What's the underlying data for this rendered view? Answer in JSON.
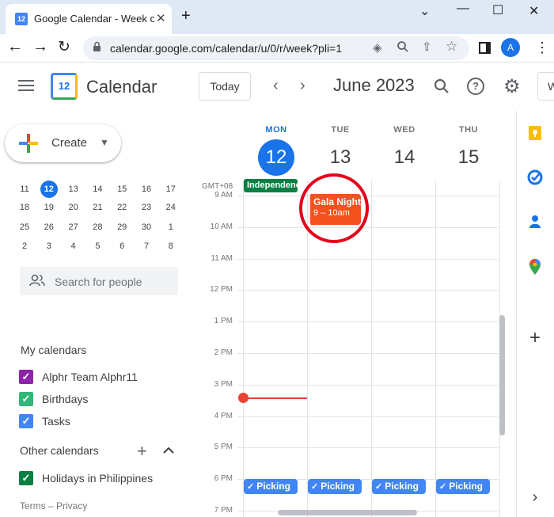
{
  "browser": {
    "tab_title": "Google Calendar - Week of",
    "tab_favicon_text": "12",
    "url": "calendar.google.com/calendar/u/0/r/week?pli=1",
    "avatar_letter": "A"
  },
  "header": {
    "app_name": "Calendar",
    "logo_text": "12",
    "today_label": "Today",
    "month_label": "June 2023",
    "view_label": "W"
  },
  "sidebar": {
    "create_label": "Create",
    "mini_calendar": [
      [
        {
          "d": "11"
        },
        {
          "d": "12",
          "sel": true
        },
        {
          "d": "13"
        },
        {
          "d": "14"
        },
        {
          "d": "15"
        },
        {
          "d": "16"
        },
        {
          "d": "17"
        }
      ],
      [
        {
          "d": "18"
        },
        {
          "d": "19"
        },
        {
          "d": "20"
        },
        {
          "d": "21"
        },
        {
          "d": "22"
        },
        {
          "d": "23"
        },
        {
          "d": "24"
        }
      ],
      [
        {
          "d": "25"
        },
        {
          "d": "26"
        },
        {
          "d": "27"
        },
        {
          "d": "28"
        },
        {
          "d": "29"
        },
        {
          "d": "30"
        },
        {
          "d": "1"
        }
      ],
      [
        {
          "d": "2"
        },
        {
          "d": "3"
        },
        {
          "d": "4"
        },
        {
          "d": "5"
        },
        {
          "d": "6"
        },
        {
          "d": "7"
        },
        {
          "d": "8"
        }
      ]
    ],
    "search_placeholder": "Search for people",
    "my_calendars_title": "My calendars",
    "my_calendars": [
      {
        "label": "Alphr Team Alphr11",
        "color": "#8e24aa"
      },
      {
        "label": "Birthdays",
        "color": "#33b679"
      },
      {
        "label": "Tasks",
        "color": "#4285f4"
      }
    ],
    "other_calendars_title": "Other calendars",
    "other_calendars": [
      {
        "label": "Holidays in Philippines",
        "color": "#0b8043"
      }
    ],
    "footer": "Terms – Privacy"
  },
  "week": {
    "timezone": "GMT+08",
    "days": [
      {
        "dow": "MON",
        "num": "12",
        "today": true
      },
      {
        "dow": "TUE",
        "num": "13",
        "today": false
      },
      {
        "dow": "WED",
        "num": "14",
        "today": false
      },
      {
        "dow": "THU",
        "num": "15",
        "today": false
      }
    ],
    "time_labels": [
      "9 AM",
      "10 AM",
      "11 AM",
      "12 PM",
      "1 PM",
      "2 PM",
      "3 PM",
      "4 PM",
      "5 PM",
      "6 PM",
      "7 PM"
    ],
    "all_day_event": "Independence Day",
    "gala_event": {
      "title": "Gala Night",
      "time": "9 – 10am",
      "color": "#f4511e"
    },
    "task_label": "Picking",
    "task_color": "#4285f4"
  }
}
